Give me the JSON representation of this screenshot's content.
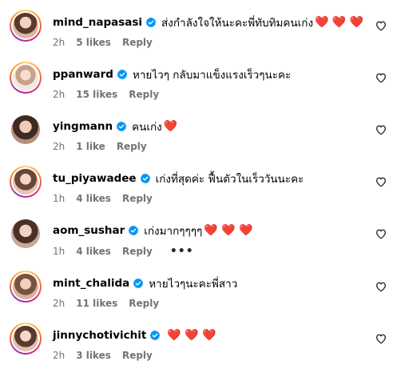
{
  "colors": {
    "verified": "#0095f6",
    "heart": "#e8174c",
    "meta_text": "#737373",
    "story_ring": "#d62976"
  },
  "icons": {
    "verified": "verified-badge-icon",
    "like": "heart-outline-icon",
    "emoji": "red-heart-emoji",
    "more": "more-options-icon"
  },
  "comments": [
    {
      "username": "mind_napasasi",
      "text": "ส่งกำลังใจให้นะคะพี่ทับทิมคนเก่ง",
      "hearts": "❤️ ❤️ ❤️",
      "time": "2h",
      "likes": "5 likes",
      "reply": "Reply"
    },
    {
      "username": "ppanward",
      "text": "หายไวๆ กลับมาแข็งแรงเร็วๆนะคะ",
      "hearts": "",
      "time": "2h",
      "likes": "15 likes",
      "reply": "Reply"
    },
    {
      "username": "yingmann",
      "text": "คนเก่ง",
      "hearts": "❤️",
      "time": "2h",
      "likes": "1 like",
      "reply": "Reply"
    },
    {
      "username": "tu_piyawadee",
      "text": "เก่งที่สุดค่ะ ฟื้นตัวในเร็ววันนะคะ",
      "hearts": "",
      "time": "1h",
      "likes": "4 likes",
      "reply": "Reply"
    },
    {
      "username": "aom_sushar",
      "text": "เก่งมากๆๆๆๆ",
      "hearts": "❤️ ❤️ ❤️",
      "time": "1h",
      "likes": "4 likes",
      "reply": "Reply",
      "more": "•••"
    },
    {
      "username": "mint_chalida",
      "text": "หายไวๆนะคะพี่สาว",
      "hearts": "",
      "time": "2h",
      "likes": "11 likes",
      "reply": "Reply"
    },
    {
      "username": "jinnychotivichit",
      "text": "",
      "hearts": "❤️ ❤️ ❤️",
      "time": "2h",
      "likes": "3 likes",
      "reply": "Reply"
    }
  ]
}
